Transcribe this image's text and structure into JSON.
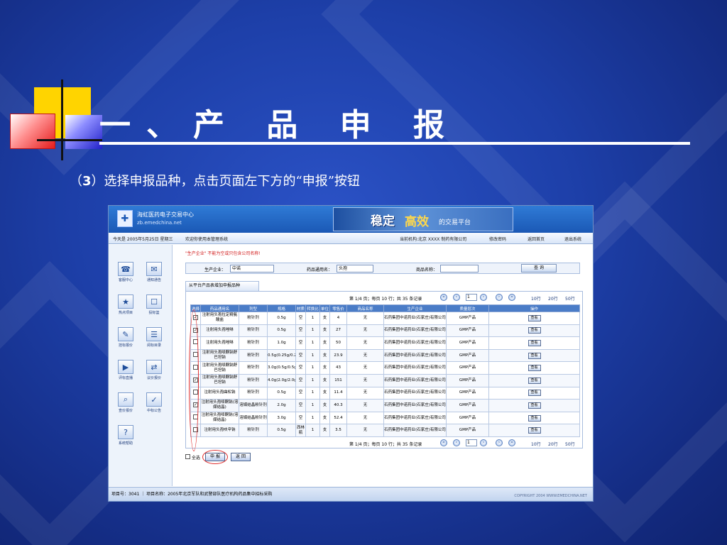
{
  "slide": {
    "title": "一、产 品 申 报",
    "subtitle_num": "3",
    "subtitle_text": "选择申报品种，点击页面左下方的“申报”按钮"
  },
  "header": {
    "site_name": "海虹医药电子交易中心",
    "site_url": "zb.emedchina.net",
    "banner_word1": "稳定",
    "banner_word2": "高效",
    "banner_suffix": "的交易平台"
  },
  "nav": {
    "date": "今天是 2005年5月25日 星期三",
    "welcome": "欢迎你使用本管理系统",
    "org": "当前机构:北京 XXXX 制药有限公司",
    "items": [
      "修改密码",
      "返回首页",
      "退出系统"
    ]
  },
  "sidebar": {
    "items": [
      {
        "label": "客服中心",
        "icon": "headset-icon",
        "glyph": "☎"
      },
      {
        "label": "通知通告",
        "icon": "bell-icon",
        "glyph": "✉"
      },
      {
        "label": "热点项目",
        "icon": "star-icon",
        "glyph": "★"
      },
      {
        "label": "投标篮",
        "icon": "basket-icon",
        "glyph": "☐"
      },
      {
        "label": "挂标报价",
        "icon": "price-icon",
        "glyph": "✎"
      },
      {
        "label": "阅标目录",
        "icon": "catalog-icon",
        "glyph": "☰"
      },
      {
        "label": "评标直播",
        "icon": "broadcast-icon",
        "glyph": "▶"
      },
      {
        "label": "议价报价",
        "icon": "negotiate-icon",
        "glyph": "⇄"
      },
      {
        "label": "查价报价",
        "icon": "query-icon",
        "glyph": "⌕"
      },
      {
        "label": "中标公告",
        "icon": "announce-icon",
        "glyph": "✓"
      },
      {
        "label": "系统帮助",
        "icon": "help-icon",
        "glyph": "?"
      }
    ]
  },
  "form": {
    "warning": "\"生产企业\" 不能为空或只包含公司名称!",
    "producer_label": "生产企业：",
    "producer_value": "中诺",
    "generic_label": "药品通用名：",
    "generic_value": "头孢",
    "product_label": "商品名称：",
    "product_value": "",
    "search_button": "查 询"
  },
  "panel": {
    "tab_label": "从平台产品表增加申报品种",
    "pager": {
      "text": "第 1/4 页；每页 10 行；共 35 条记录",
      "page_value": "1",
      "size_options": [
        "10行",
        "20行",
        "50行"
      ]
    },
    "columns": [
      "选择",
      "药品通用名",
      "剂型",
      "规格",
      "材质",
      "转换比",
      "单位",
      "零售价",
      "商品名称",
      "生产企业",
      "质量层次",
      "操作"
    ],
    "rows": [
      {
        "checked": "✓",
        "cells": [
          "注射用头孢拉定精氨酸盐",
          "粉针剂",
          "0.5g",
          "空",
          "1",
          "支",
          "4",
          "无",
          "石药集团中诺药业(石家庄)有限公司",
          "GMP产品"
        ]
      },
      {
        "checked": "✓",
        "cells": [
          "注射用头孢唑啉",
          "粉针剂",
          "0.5g",
          "空",
          "1",
          "支",
          "27",
          "无",
          "石药集团中诺药业(石家庄)有限公司",
          "GMP产品"
        ]
      },
      {
        "checked": "",
        "cells": [
          "注射用头孢唑啉",
          "粉针剂",
          "1.0g",
          "空",
          "1",
          "支",
          "50",
          "无",
          "石药集团中诺药业(石家庄)有限公司",
          "GMP产品"
        ]
      },
      {
        "checked": "",
        "cells": [
          "注射用头孢哌酮钠舒巴坦钠",
          "粉针剂",
          "0.5g(0.25g/0.25g)",
          "空",
          "1",
          "支",
          "23.9",
          "无",
          "石药集团中诺药业(石家庄)有限公司",
          "GMP产品"
        ]
      },
      {
        "checked": "",
        "cells": [
          "注射用头孢哌酮钠舒巴坦钠",
          "粉针剂",
          "3.0g(0.5g/0.5g)",
          "空",
          "1",
          "支",
          "43",
          "无",
          "石药集团中诺药业(石家庄)有限公司",
          "GMP产品"
        ]
      },
      {
        "checked": "✓",
        "cells": [
          "注射用头孢哌酮钠舒巴坦钠",
          "粉针剂",
          "4.0g(2.0g/2.0g)",
          "空",
          "1",
          "支",
          "151",
          "无",
          "石药集团中诺药业(石家庄)有限公司",
          "GMP产品"
        ]
      },
      {
        "checked": "",
        "cells": [
          "注射用头孢曲松钠",
          "粉针剂",
          "0.5g",
          "空",
          "1",
          "支",
          "11.4",
          "无",
          "石药集团中诺药业(石家庄)有限公司",
          "GMP产品"
        ]
      },
      {
        "checked": "✓",
        "cells": [
          "注射用头孢哌酮钠(溶媒结晶)",
          "溶媒结晶粉针剂",
          "2.0g",
          "空",
          "1",
          "支",
          "40.3",
          "无",
          "石药集团中诺药业(石家庄)有限公司",
          "GMP产品"
        ]
      },
      {
        "checked": "",
        "cells": [
          "注射用头孢哌酮钠(溶媒结晶)",
          "溶媒结晶粉针剂",
          "3.0g",
          "空",
          "1",
          "支",
          "52.4",
          "无",
          "石药集团中诺药业(石家庄)有限公司",
          "GMP产品"
        ]
      },
      {
        "checked": "",
        "cells": [
          "注射用头孢呋辛钠",
          "粉针剂",
          "0.5g",
          "西林瓶",
          "1",
          "支",
          "3.5",
          "无",
          "石药集团中诺药业(石家庄)有限公司",
          "GMP产品"
        ]
      }
    ],
    "row_action": "查看"
  },
  "actions": {
    "select_all": "全选",
    "declare": "申 报",
    "back": "返 回"
  },
  "footer": {
    "left": "项目号：3041 ｜ 项目名称：2005年北京军队和武警部队医疗机构药品集中招标采购",
    "right": "COPYRIGHT 2004 WWW.EMEDCHINA.NET"
  }
}
